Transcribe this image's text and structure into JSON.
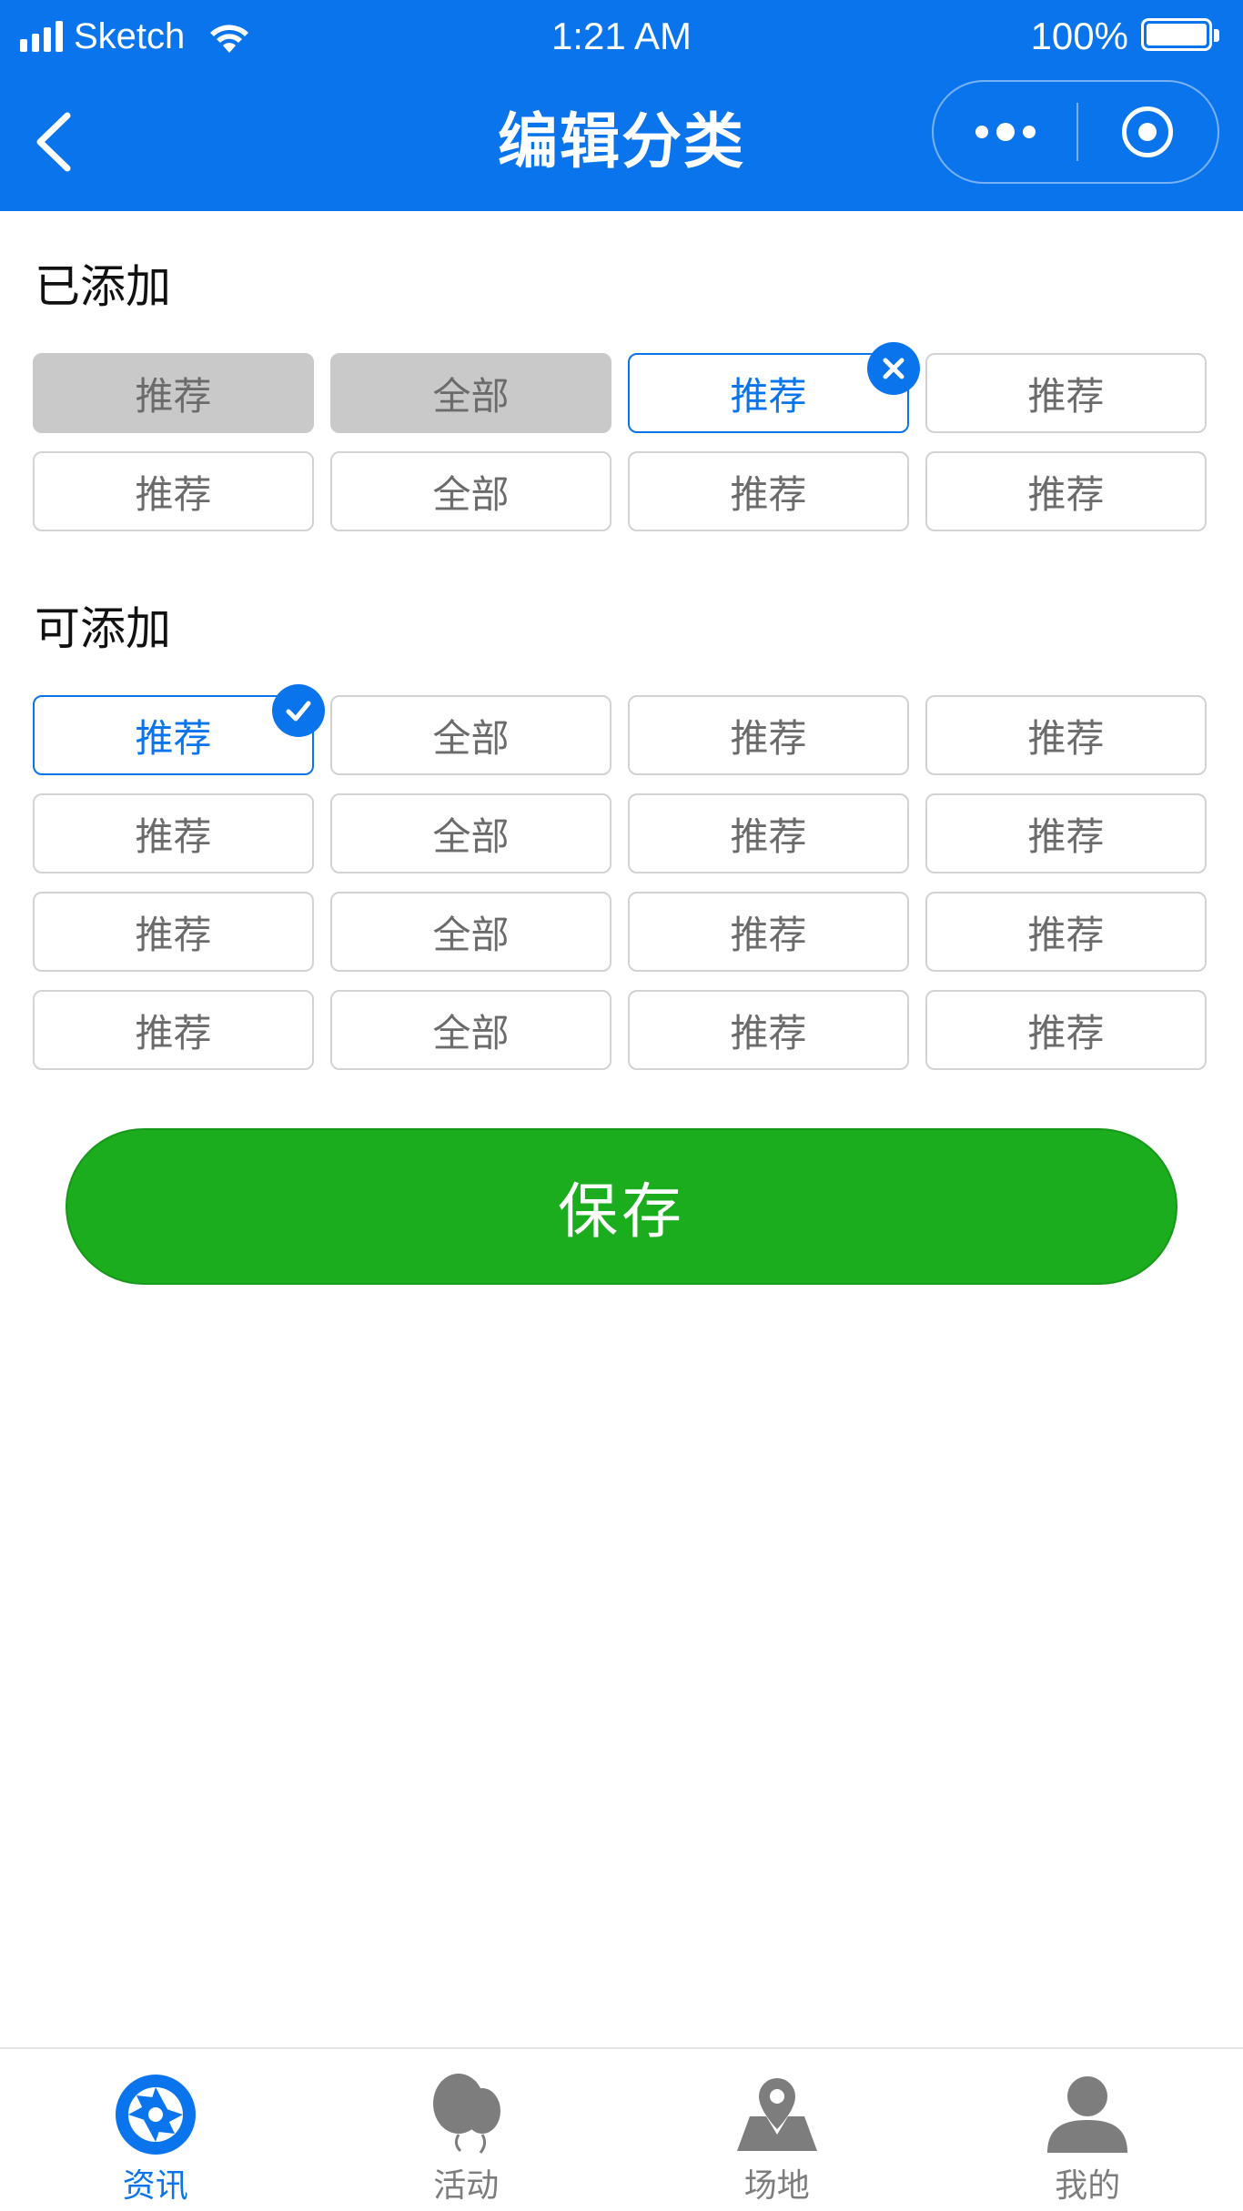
{
  "status_bar": {
    "carrier": "Sketch",
    "time": "1:21 AM",
    "battery": "100%"
  },
  "nav": {
    "title": "编辑分类"
  },
  "added": {
    "title": "已添加",
    "tags": [
      {
        "label": "推荐",
        "state": "disabled"
      },
      {
        "label": "全部",
        "state": "disabled"
      },
      {
        "label": "推荐",
        "state": "selected",
        "badge": "remove"
      },
      {
        "label": "推荐",
        "state": "normal"
      },
      {
        "label": "推荐",
        "state": "normal"
      },
      {
        "label": "全部",
        "state": "normal"
      },
      {
        "label": "推荐",
        "state": "normal"
      },
      {
        "label": "推荐",
        "state": "normal"
      }
    ]
  },
  "available": {
    "title": "可添加",
    "tags": [
      {
        "label": "推荐",
        "state": "selected",
        "badge": "check"
      },
      {
        "label": "全部",
        "state": "normal"
      },
      {
        "label": "推荐",
        "state": "normal"
      },
      {
        "label": "推荐",
        "state": "normal"
      },
      {
        "label": "推荐",
        "state": "normal"
      },
      {
        "label": "全部",
        "state": "normal"
      },
      {
        "label": "推荐",
        "state": "normal"
      },
      {
        "label": "推荐",
        "state": "normal"
      },
      {
        "label": "推荐",
        "state": "normal"
      },
      {
        "label": "全部",
        "state": "normal"
      },
      {
        "label": "推荐",
        "state": "normal"
      },
      {
        "label": "推荐",
        "state": "normal"
      },
      {
        "label": "推荐",
        "state": "normal"
      },
      {
        "label": "全部",
        "state": "normal"
      },
      {
        "label": "推荐",
        "state": "normal"
      },
      {
        "label": "推荐",
        "state": "normal"
      }
    ]
  },
  "save_label": "保存",
  "tab_bar": {
    "items": [
      {
        "label": "资讯",
        "icon": "aperture-icon",
        "active": true
      },
      {
        "label": "活动",
        "icon": "balloon-icon",
        "active": false
      },
      {
        "label": "场地",
        "icon": "map-pin-icon",
        "active": false
      },
      {
        "label": "我的",
        "icon": "user-icon",
        "active": false
      }
    ]
  },
  "colors": {
    "primary": "#0a74ec",
    "save_green": "#1bad1d",
    "tag_disabled_bg": "#c9c9c9",
    "tag_border": "#d2d2d2",
    "tab_inactive": "#7d7d7d"
  }
}
